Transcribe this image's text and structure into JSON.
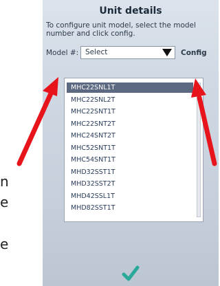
{
  "page": {
    "side_text": [
      "n",
      "e",
      "e"
    ]
  },
  "dialog": {
    "title": "Unit details",
    "instructions": "To configure unit model, select the model number and click config.",
    "model_label": "Model #:",
    "select_value": "Select",
    "config_label": "Config",
    "options": [
      "MHC22SNL1T",
      "MHC22SNL2T",
      "MHC22SNT1T",
      "MHC22SNT2T",
      "MHC24SNT2T",
      "MHC52SNT1T",
      "MHC54SNT1T",
      "MHD32SST1T",
      "MHD32SST2T",
      "MHD42SSL1T",
      "MHD82SST1T"
    ],
    "selected_index": 0,
    "confirm_icon": "checkmark-icon"
  },
  "colors": {
    "annotation_arrow": "#e8141b",
    "confirm_check": "#2aa89a",
    "selected_row": "#5c6980"
  }
}
